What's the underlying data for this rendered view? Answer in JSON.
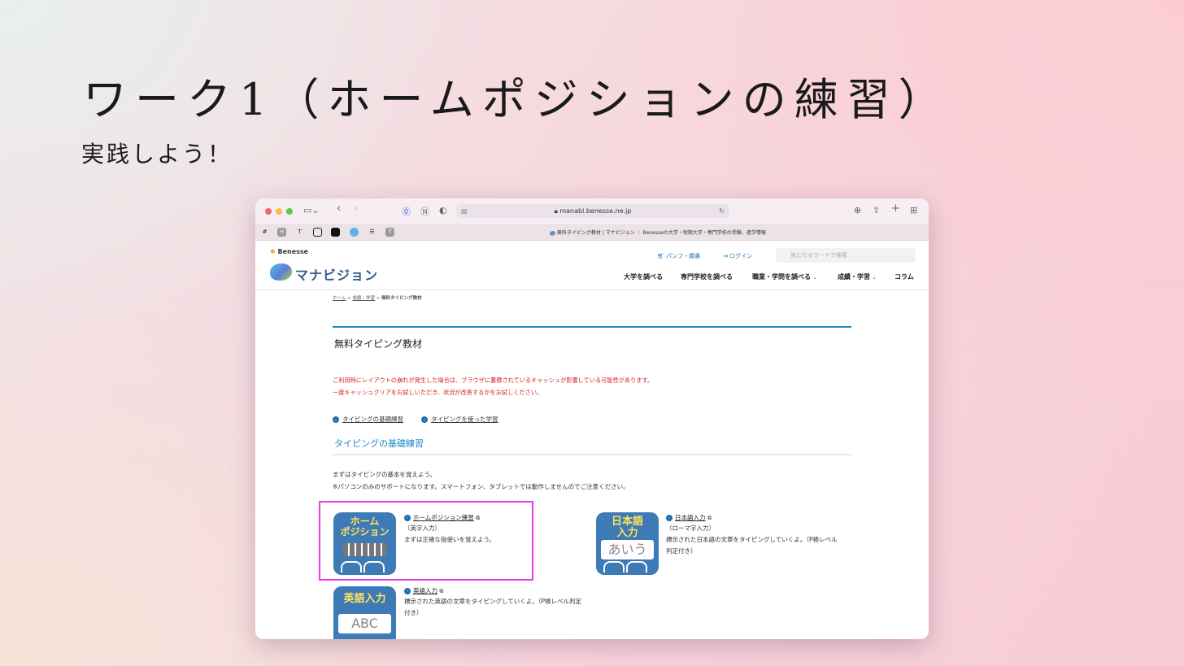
{
  "slide": {
    "title": "ワーク1（ホームポジションの練習）",
    "subtitle": "実践しよう！"
  },
  "browser": {
    "url": "manabi.benesse.ne.jp",
    "tab_title": "無料タイピング教材 | マナビジョン ｜ Benesseの大学・短期大学・専門学校の受験、進学情報"
  },
  "site": {
    "brand": "Benesse",
    "logo_text": "マナビジョン",
    "header_links": [
      "パンフ・願書",
      "ログイン"
    ],
    "search_placeholder": "気になるワードで検索",
    "nav": [
      "大学を調べる",
      "専門学校を調べる",
      "職業・学問を調べる",
      "成績・学習",
      "コラム"
    ]
  },
  "page": {
    "breadcrumb": [
      "ホーム",
      "成績・学習",
      "無料タイピング教材"
    ],
    "title": "無料タイピング教材",
    "notice": [
      "ご利用時にレイアウトの崩れが発生した場合は、ブラウザに蓄積されているキャッシュが影響している可能性があります。",
      "一度キャッシュクリアをお試しいただき、状況が改善するかをお試しください。"
    ],
    "anchors": [
      "タイピングの基礎練習",
      "タイピングを使った学習"
    ],
    "section_title": "タイピングの基礎練習",
    "intro": [
      "まずはタイピングの基本を覚えよう。",
      "※パソコンのみのサポートになります。スマートフォン、タブレットでは動作しませんのでご注意ください。"
    ],
    "items": [
      {
        "icon_label_1": "ホーム",
        "icon_label_2": "ポジション",
        "link": "ホームポジション練習",
        "sub": "（英字入力）",
        "desc": "まずは正確な指使いを覚えよう。"
      },
      {
        "icon_label_1": "日本語",
        "icon_label_2": "入力",
        "icon_panel": "あいう",
        "link": "日本語入力",
        "sub": "（ローマ字入力）",
        "desc": "標示された日本語の文章をタイピングしていくよ。（P検レベル判定付き）"
      },
      {
        "icon_label_1": "英語入力",
        "icon_panel": "ABC",
        "link": "英語入力",
        "desc": "標示された英語の文章をタイピングしていくよ。（P検レベル判定付き）"
      }
    ]
  },
  "colors": {
    "accent_blue": "#1e88c8",
    "notice_red": "#d6262b",
    "highlight_magenta": "#ea3de8",
    "icon_blue": "#3e7ab6",
    "icon_yellow": "#ffe45c"
  }
}
